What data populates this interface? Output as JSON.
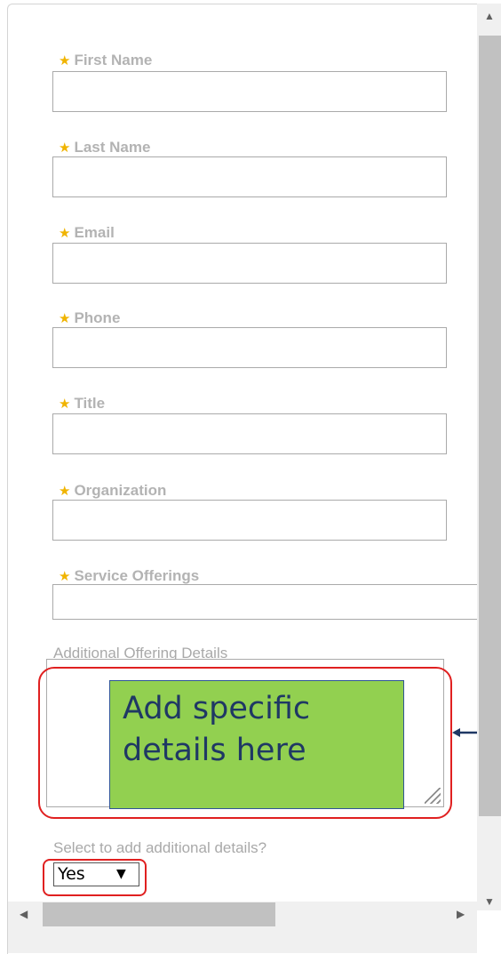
{
  "form": {
    "fields": [
      {
        "label": "First Name",
        "required": true,
        "value": ""
      },
      {
        "label": "Last Name",
        "required": true,
        "value": ""
      },
      {
        "label": "Email",
        "required": true,
        "value": ""
      },
      {
        "label": "Phone",
        "required": true,
        "value": ""
      },
      {
        "label": "Title",
        "required": true,
        "value": ""
      },
      {
        "label": "Organization",
        "required": true,
        "value": ""
      },
      {
        "label": "Service Offerings",
        "required": true,
        "value": ""
      }
    ],
    "details_label": "Additional Offering Details",
    "details_value": "",
    "select_label": "Select to add additional details?",
    "select_value": "Yes"
  },
  "callout": {
    "text": "Add specific details here",
    "fill_color": "#92d050",
    "outline_color": "#e02020"
  },
  "icons": {
    "required": "star-icon",
    "dropdown": "triangle-down-icon"
  }
}
